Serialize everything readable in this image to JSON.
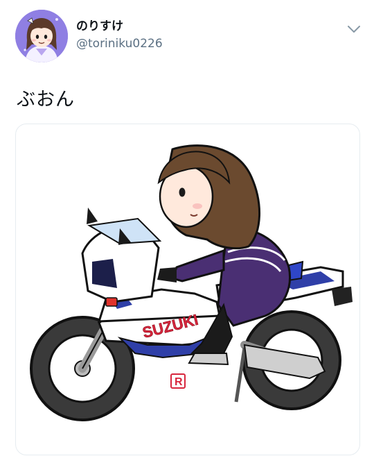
{
  "user": {
    "display_name": "のりすけ",
    "handle": "@toriniku0226",
    "avatar_icon": "girl-avatar-icon"
  },
  "tweet": {
    "text": "ぶおん"
  },
  "media": {
    "logo_text": "SUZUKI",
    "badge_text": "R"
  },
  "colors": {
    "handle": "#5b7083",
    "suit": "#4a2f73",
    "fairing_blue": "#2f3fa8",
    "logo_red": "#d7263d"
  }
}
